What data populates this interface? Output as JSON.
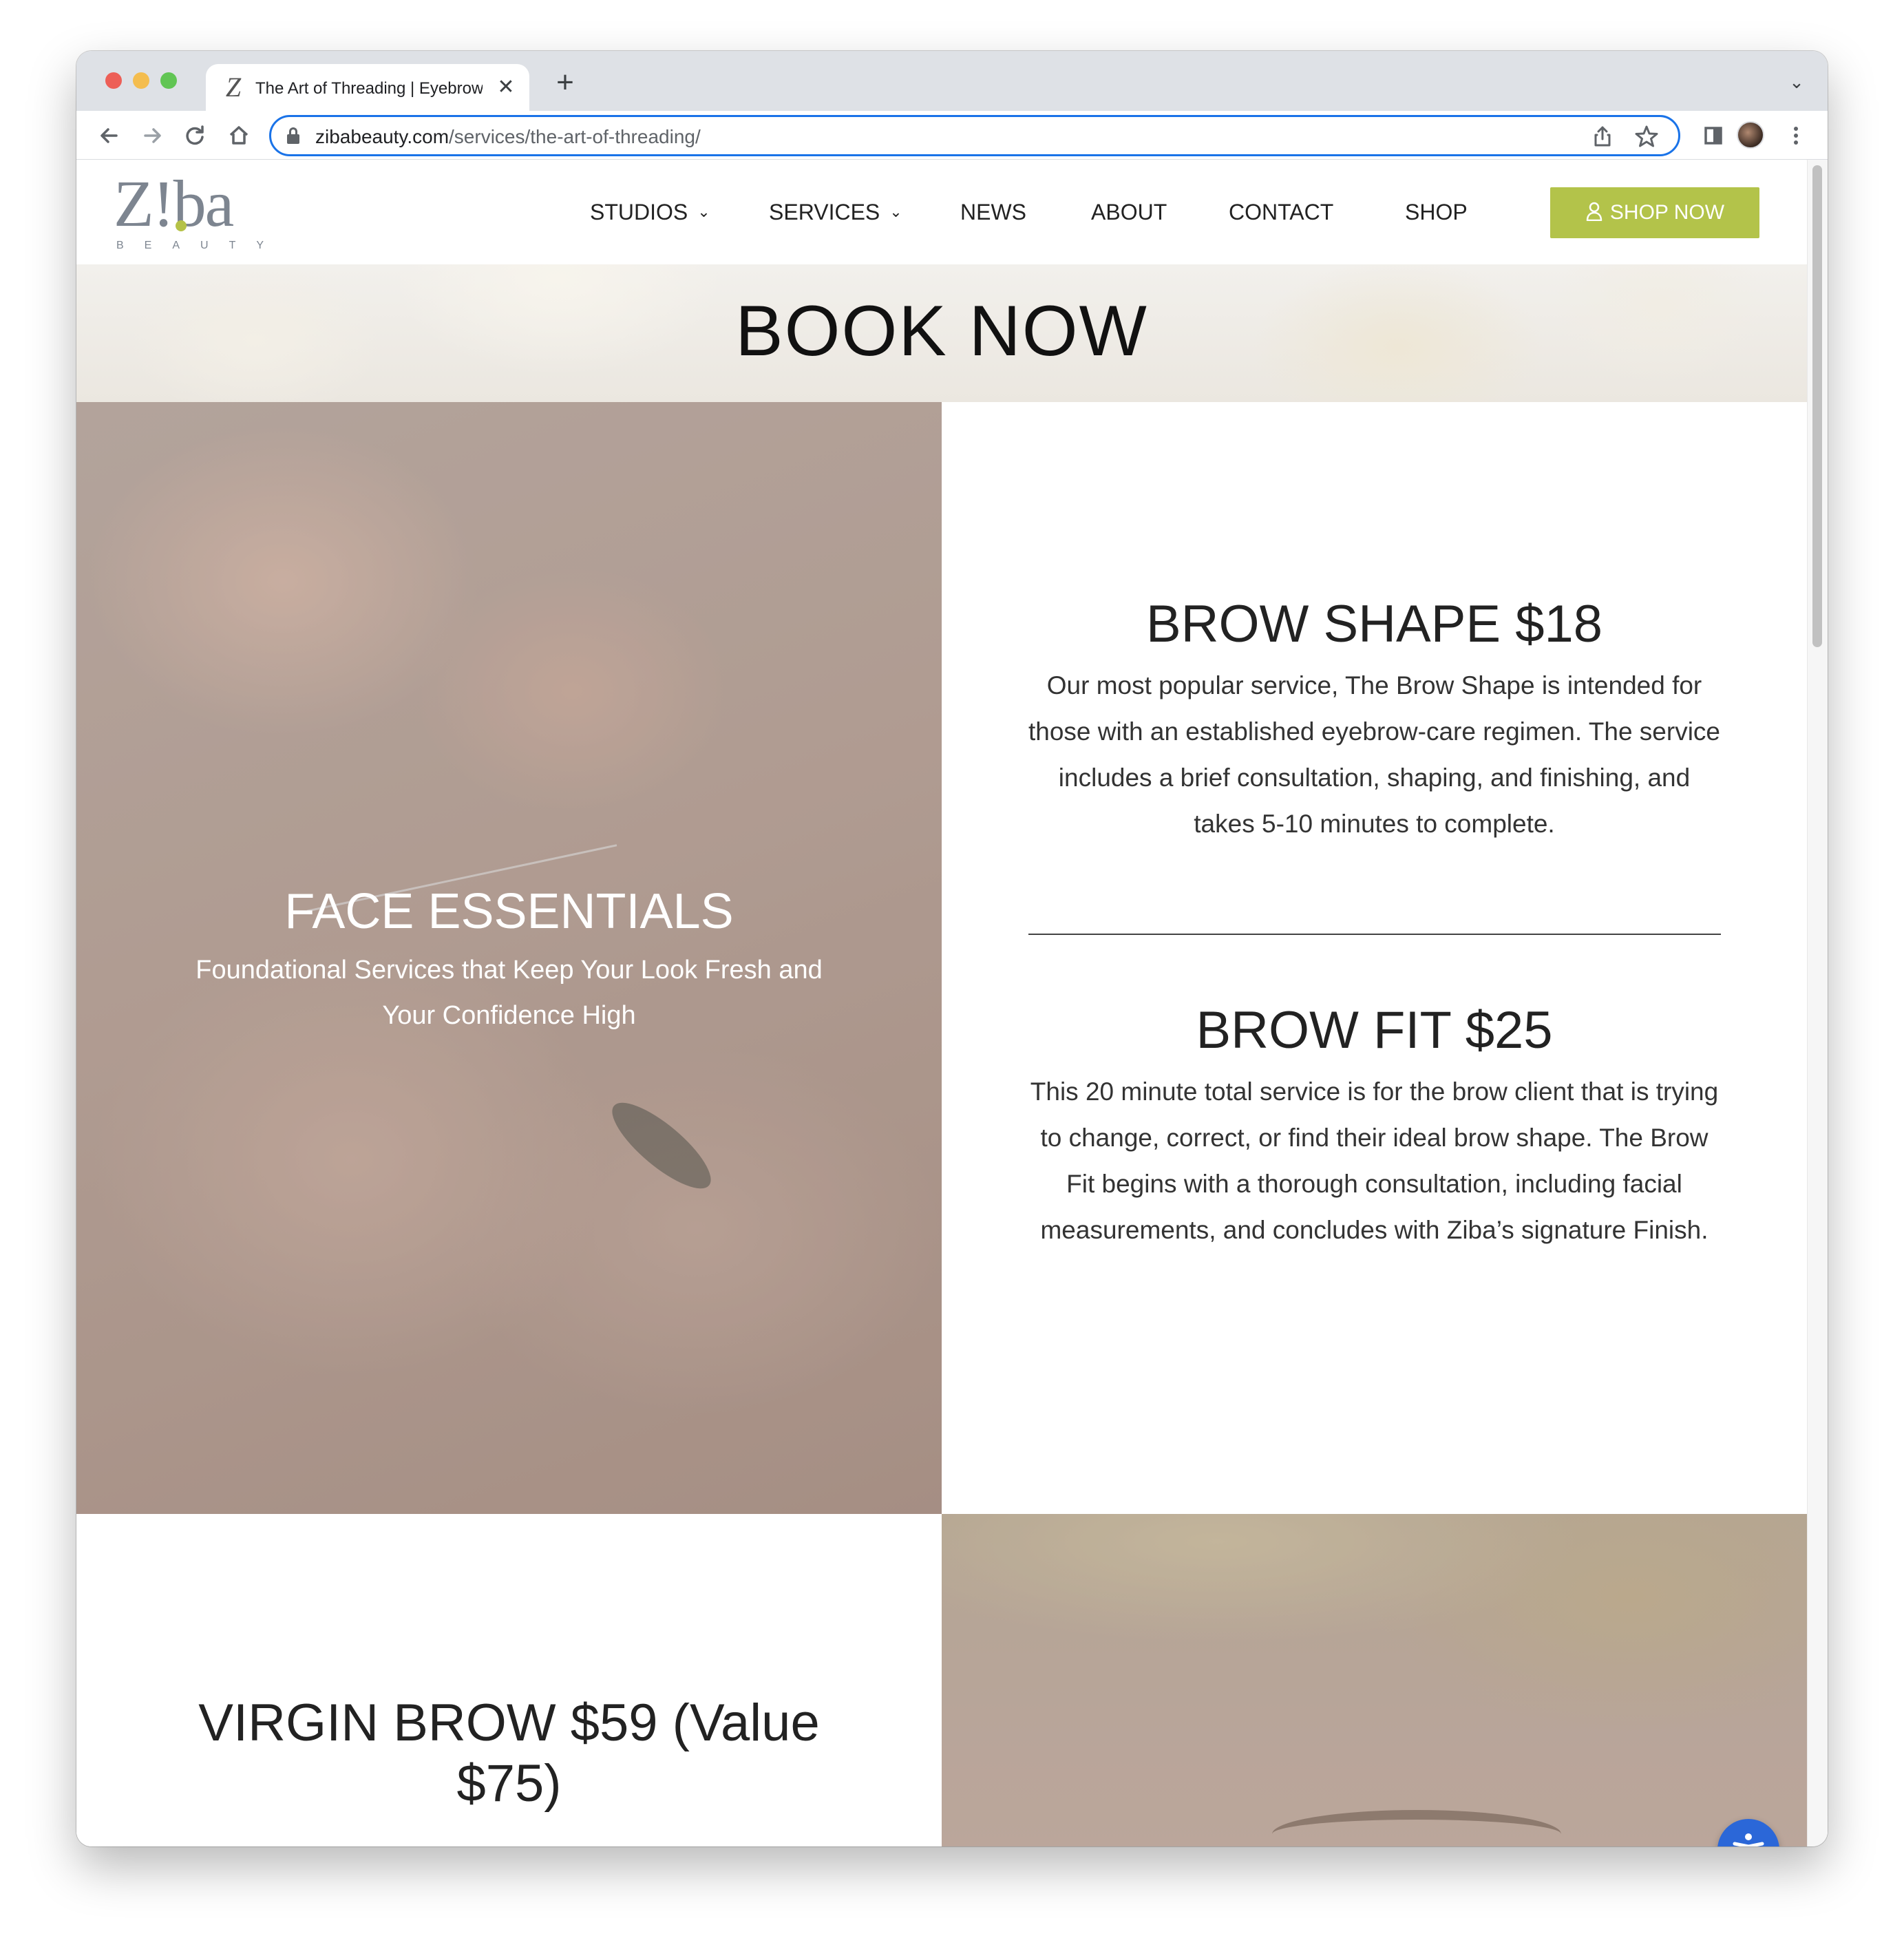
{
  "browser": {
    "tab_title": "The Art of Threading | Eyebrow",
    "tab_favicon": "Z",
    "new_tab": "+",
    "close_tab": "✕",
    "url_host": "zibabeauty.com",
    "url_path": "/services/the-art-of-threading/"
  },
  "site": {
    "logo_text": "Z!ba",
    "logo_sub": "BEAUTY",
    "nav": [
      {
        "label": "STUDIOS",
        "dropdown": true
      },
      {
        "label": "SERVICES",
        "dropdown": true
      },
      {
        "label": "NEWS",
        "dropdown": false
      },
      {
        "label": "ABOUT",
        "dropdown": false
      },
      {
        "label": "CONTACT",
        "dropdown": false
      },
      {
        "label": "SHOP",
        "dropdown": false
      }
    ],
    "shop_now_label": "SHOP NOW",
    "accent_color": "#b3c34a"
  },
  "hero": {
    "title": "BOOK NOW"
  },
  "face_essentials": {
    "title": "FACE ESSENTIALS",
    "subtitle": "Foundational Services that Keep Your Look Fresh and Your Confidence High"
  },
  "services": [
    {
      "title": "BROW SHAPE $18",
      "description": "Our most popular service, The Brow Shape is intended for those with an established eyebrow-care regimen. The service includes a brief consultation, shaping, and finishing, and takes 5-10 minutes to complete."
    },
    {
      "title": "BROW FIT $25",
      "description": "This 20 minute total service is for the brow client that is trying to change, correct, or find their ideal brow shape. The Brow Fit begins with a thorough consultation, including facial measurements, and concludes with Ziba’s signature Finish."
    },
    {
      "title": "VIRGIN BROW $59 (Value $75)"
    }
  ],
  "icons": {
    "back": "arrow-left-icon",
    "forward": "arrow-right-icon",
    "reload": "reload-icon",
    "home": "home-icon",
    "lock": "lock-icon",
    "share": "share-icon",
    "bookmark": "star-icon",
    "side_panel": "side-panel-icon",
    "menu": "kebab-menu-icon",
    "accessibility": "accessibility-icon"
  }
}
